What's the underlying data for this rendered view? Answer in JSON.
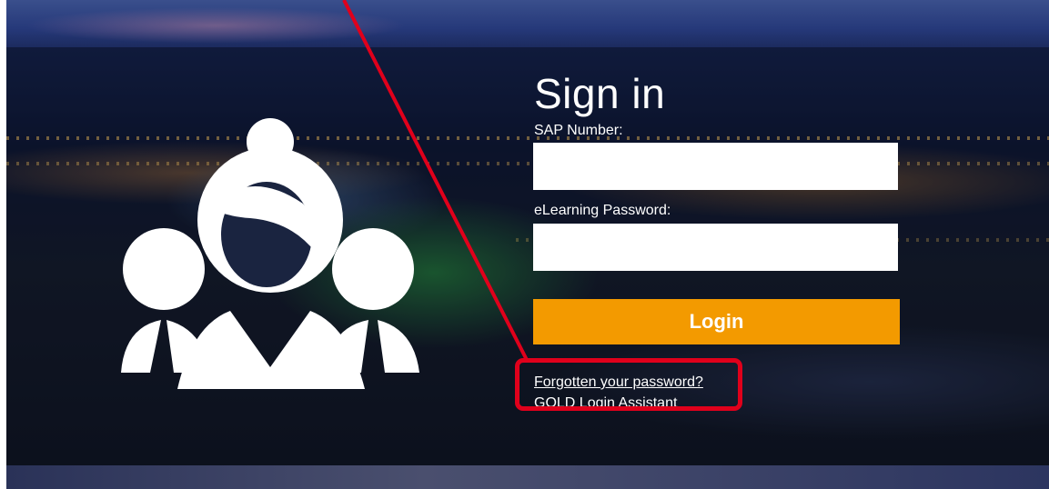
{
  "signin": {
    "title": "Sign in",
    "sap_label": "SAP Number:",
    "sap_value": "",
    "password_label": "eLearning Password:",
    "password_value": "",
    "login_label": "Login",
    "forgot_link": "Forgotten your password?",
    "gold_link": "GOLD Login Assistant"
  },
  "icons": {
    "hero": "people-group-icon"
  },
  "annotation": {
    "color": "#e0001b",
    "type": "arrow-and-highlight-box"
  },
  "colors": {
    "accent": "#f39a00",
    "text": "#ffffff"
  }
}
